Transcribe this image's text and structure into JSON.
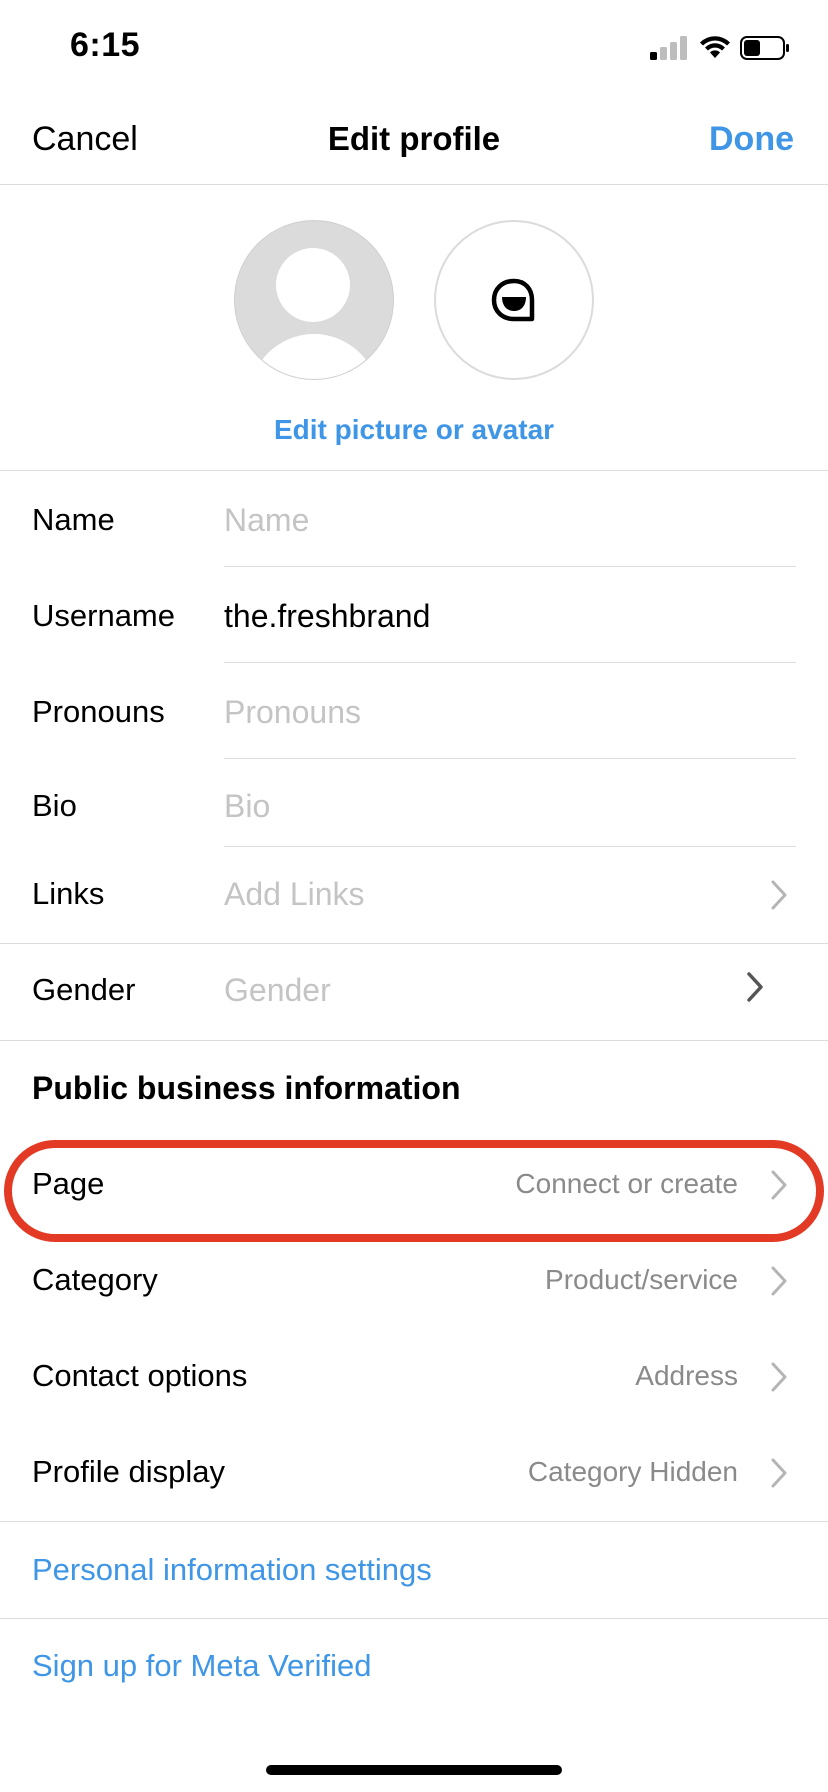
{
  "status_bar": {
    "time": "6:15"
  },
  "nav": {
    "cancel": "Cancel",
    "title": "Edit profile",
    "done": "Done"
  },
  "avatar": {
    "edit_label": "Edit picture or avatar"
  },
  "fields": {
    "name": {
      "label": "Name",
      "placeholder": "Name"
    },
    "username": {
      "label": "Username",
      "value": "the.freshbrand"
    },
    "pronouns": {
      "label": "Pronouns",
      "placeholder": "Pronouns"
    },
    "bio": {
      "label": "Bio",
      "placeholder": "Bio"
    },
    "links": {
      "label": "Links",
      "placeholder": "Add Links"
    },
    "gender": {
      "label": "Gender",
      "placeholder": "Gender"
    }
  },
  "business": {
    "heading": "Public business information",
    "rows": [
      {
        "label": "Page",
        "value": "Connect or create"
      },
      {
        "label": "Category",
        "value": "Product/service"
      },
      {
        "label": "Contact options",
        "value": "Address"
      },
      {
        "label": "Profile display",
        "value": "Category Hidden"
      }
    ]
  },
  "links": {
    "personal_info": "Personal information settings",
    "meta_verified": "Sign up for Meta Verified"
  },
  "colors": {
    "accent": "#3f96e6",
    "highlight": "#e23a25"
  }
}
